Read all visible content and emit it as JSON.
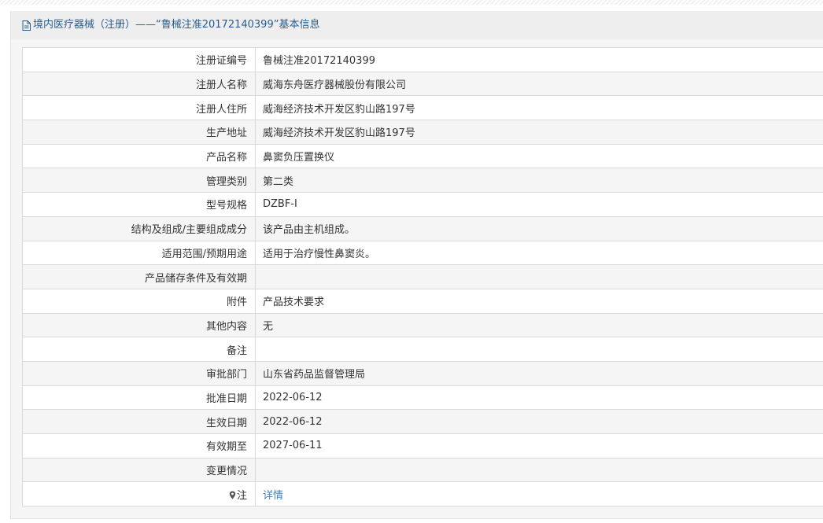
{
  "header": {
    "title": "境内医疗器械（注册）——“鲁械注准20172140399”基本信息"
  },
  "fields": [
    {
      "label": "注册证编号",
      "value": "鲁械注准20172140399"
    },
    {
      "label": "注册人名称",
      "value": "威海东舟医疗器械股份有限公司"
    },
    {
      "label": "注册人住所",
      "value": "威海经济技术开发区豹山路197号"
    },
    {
      "label": "生产地址",
      "value": "威海经济技术开发区豹山路197号"
    },
    {
      "label": "产品名称",
      "value": "鼻窦负压置换仪"
    },
    {
      "label": "管理类别",
      "value": "第二类"
    },
    {
      "label": "型号规格",
      "value": "DZBF-I"
    },
    {
      "label": "结构及组成/主要组成成分",
      "value": "该产品由主机组成。"
    },
    {
      "label": "适用范围/预期用途",
      "value": "适用于治疗慢性鼻窦炎。"
    },
    {
      "label": "产品储存条件及有效期",
      "value": ""
    },
    {
      "label": "附件",
      "value": "产品技术要求"
    },
    {
      "label": "其他内容",
      "value": "无"
    },
    {
      "label": "备注",
      "value": ""
    },
    {
      "label": "审批部门",
      "value": "山东省药品监督管理局"
    },
    {
      "label": "批准日期",
      "value": "2022-06-12"
    },
    {
      "label": "生效日期",
      "value": "2022-06-12"
    },
    {
      "label": "有效期至",
      "value": "2027-06-11"
    },
    {
      "label": "变更情况",
      "value": ""
    }
  ],
  "note": {
    "label": "注",
    "icon": "map-pin-icon",
    "link_text": "详情"
  }
}
